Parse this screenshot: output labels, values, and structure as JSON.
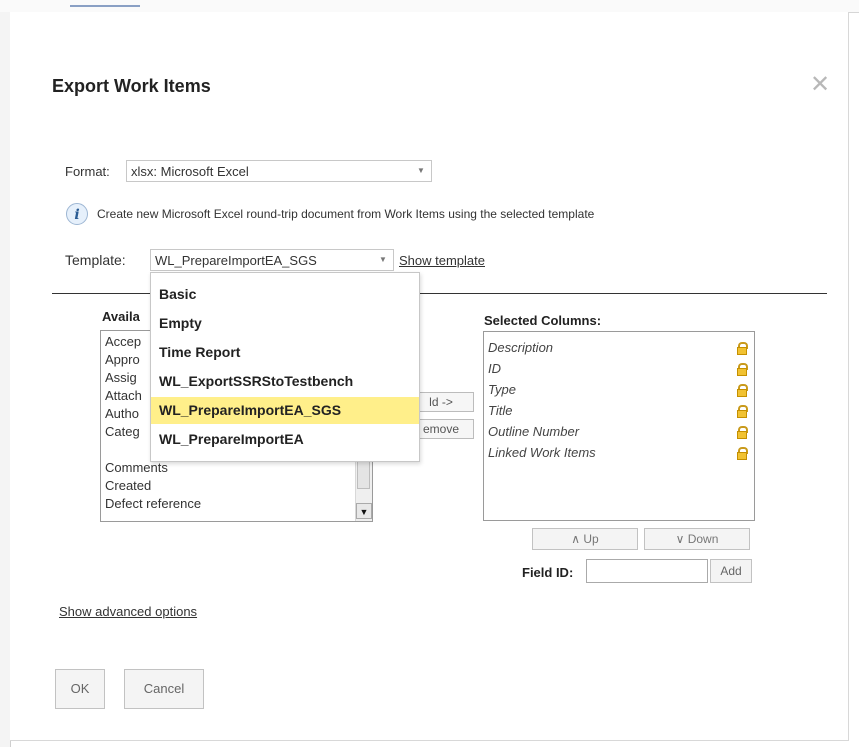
{
  "dialog": {
    "title": "Export Work Items",
    "close_icon": "close-icon"
  },
  "format": {
    "label": "Format:",
    "value": "xlsx: Microsoft Excel"
  },
  "info": {
    "text": "Create new Microsoft Excel round-trip document from Work Items using the selected template",
    "icon": "info-icon"
  },
  "template": {
    "label": "Template:",
    "value": "WL_PrepareImportEA_SGS",
    "show_link": "Show template",
    "options": [
      "Basic",
      "Empty",
      "Time Report",
      "WL_ExportSSRStoTestbench",
      "WL_PrepareImportEA_SGS",
      "WL_PrepareImportEA"
    ],
    "highlighted": "WL_PrepareImportEA_SGS",
    "highlight_color": "#ffef8a"
  },
  "available": {
    "heading": "Availa",
    "items": [
      "Accep",
      "Appro",
      "Assig",
      "Attach",
      "Autho",
      "Categ",
      "Comments",
      "Created",
      "Defect reference"
    ]
  },
  "middle_buttons": {
    "add": "ld ->",
    "remove": "emove"
  },
  "selected": {
    "heading": "Selected Columns:",
    "items": [
      "Description",
      "ID",
      "Type",
      "Title",
      "Outline Number",
      "Linked Work Items"
    ],
    "lock_icon": "lock-icon",
    "lock_color": "#f1c232"
  },
  "order_buttons": {
    "up": "∧ Up",
    "down": "∨ Down"
  },
  "field_id": {
    "label": "Field ID:",
    "value": "",
    "add": "Add"
  },
  "advanced_link": "Show advanced options",
  "footer": {
    "ok": "OK",
    "cancel": "Cancel"
  }
}
